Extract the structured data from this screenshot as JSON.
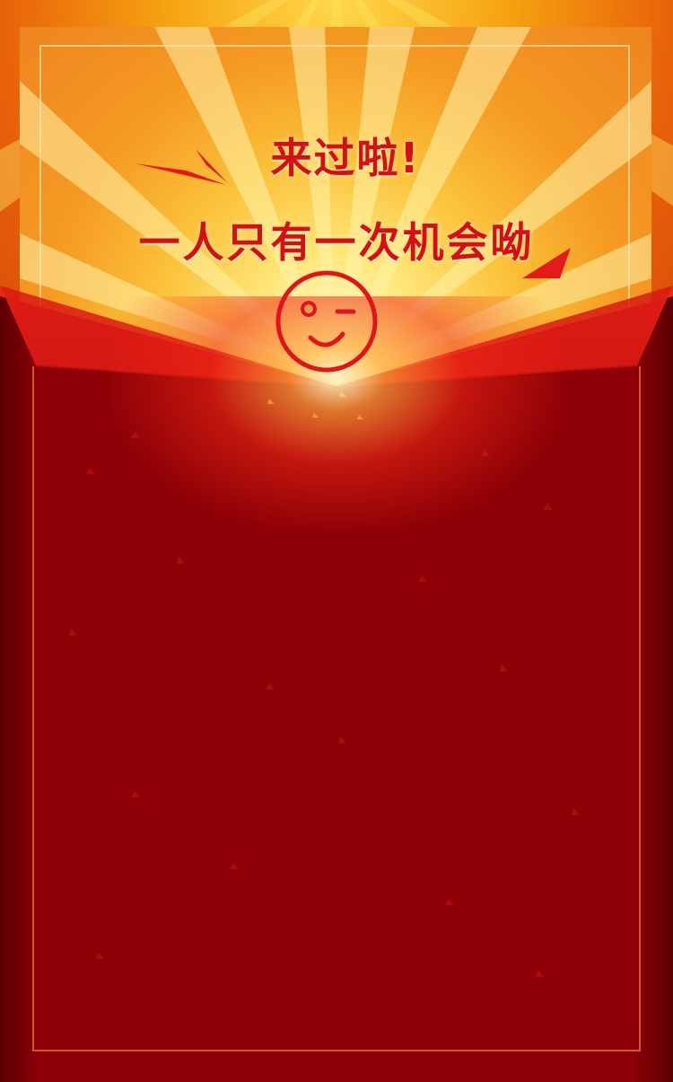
{
  "popup": {
    "headline": "来过啦!",
    "subheadline": "一人只有一次机会呦",
    "emoji_icon": "wink-smiley-icon"
  },
  "colors": {
    "text_red": "#d40f16",
    "envelope_red": "#8c0006",
    "frame_orange": "#d8571a",
    "card_orange": "#f59a22"
  }
}
